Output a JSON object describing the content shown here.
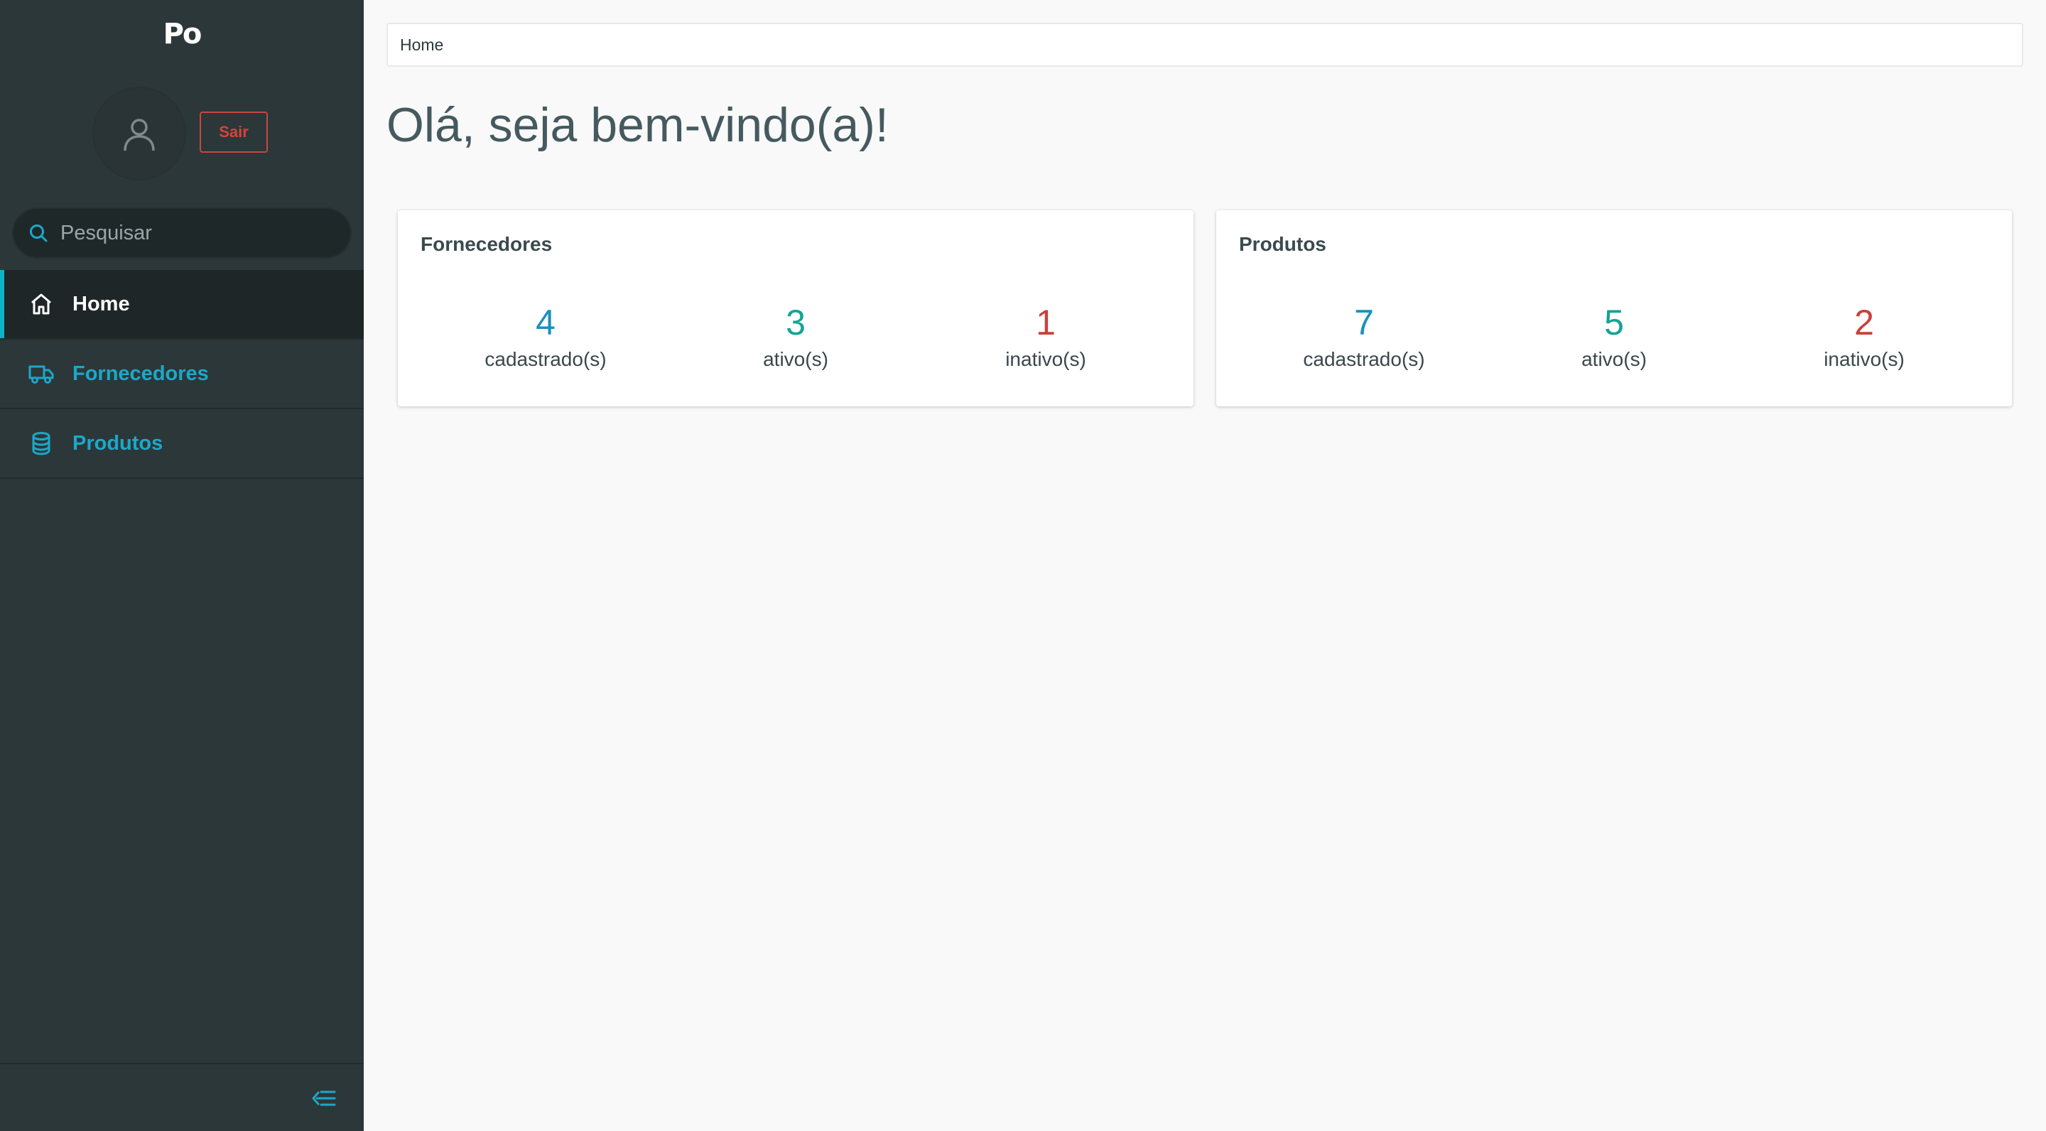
{
  "app": {
    "logo": "Po"
  },
  "sidebar": {
    "logout_label": "Sair",
    "search": {
      "placeholder": "Pesquisar",
      "value": ""
    },
    "menu": [
      {
        "label": "Home",
        "icon": "home-icon",
        "active": true
      },
      {
        "label": "Fornecedores",
        "icon": "truck-icon",
        "active": false
      },
      {
        "label": "Produtos",
        "icon": "database-icon",
        "active": false
      }
    ],
    "collapse_icon": "collapse-menu-icon"
  },
  "breadcrumb": {
    "items": [
      "Home"
    ]
  },
  "page": {
    "title": "Olá, seja bem-vindo(a)!"
  },
  "cards": [
    {
      "title": "Fornecedores",
      "stats": [
        {
          "value": "4",
          "label": "cadastrado(s)",
          "color": "#1d8fbf"
        },
        {
          "value": "3",
          "label": "ativo(s)",
          "color": "#15a394"
        },
        {
          "value": "1",
          "label": "inativo(s)",
          "color": "#c9413a"
        }
      ]
    },
    {
      "title": "Produtos",
      "stats": [
        {
          "value": "7",
          "label": "cadastrado(s)",
          "color": "#1d8fbf"
        },
        {
          "value": "5",
          "label": "ativo(s)",
          "color": "#15a394"
        },
        {
          "value": "2",
          "label": "inativo(s)",
          "color": "#c9413a"
        }
      ]
    }
  ],
  "colors": {
    "sidebar_bg": "#2c3739",
    "accent": "#1ca8c9",
    "danger": "#d7433b",
    "success": "#15a394"
  }
}
